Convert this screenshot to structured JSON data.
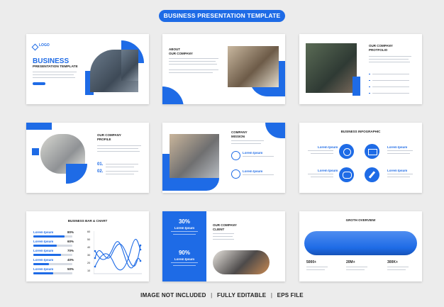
{
  "header": {
    "title": "BUSINESS PRESENTATION TEMPLATE"
  },
  "slide1": {
    "logo": "LOGO",
    "title": "BUSINESS",
    "subtitle": "PRESENTATION TEMPLATE"
  },
  "slide2": {
    "title": "ABOUT\nOUR COMPANY"
  },
  "slide3": {
    "title": "OUR COMPANY\nPROTFOLIO"
  },
  "slide4": {
    "title": "OUR COMPANY\nPROFILE",
    "num1": "01.",
    "num2": "02."
  },
  "slide5": {
    "title": "COMPANY\nMISSION",
    "item1": "Lorem Ipsum",
    "item2": "Lorem Ipsum"
  },
  "slide6": {
    "title": "BUSINESS INFOGRAPHIC",
    "labels": [
      "Lorem Ipsum",
      "Lorem Ipsum",
      "Lorem Ipsum",
      "Lorem Ipsum"
    ]
  },
  "slide7": {
    "title": "BUSINESS BAR & CHART",
    "bars": [
      {
        "label": "Lorem Ipsum",
        "pct": "80%",
        "value": 0.8
      },
      {
        "label": "Lorem Ipsum",
        "pct": "60%",
        "value": 0.6
      },
      {
        "label": "Lorem Ipsum",
        "pct": "70%",
        "value": 0.7
      },
      {
        "label": "Lorem Ipsum",
        "pct": "40%",
        "value": 0.4
      },
      {
        "label": "Lorem Ipsum",
        "pct": "50%",
        "value": 0.5
      }
    ],
    "yticks": [
      "60",
      "50",
      "40",
      "30",
      "20",
      "10"
    ]
  },
  "slide8": {
    "stat1": "30%",
    "stat2": "90%",
    "stat1_label": "Lorem Ipsum",
    "stat2_label": "Lorem Ipsum",
    "title": "OUR COMPANY\nCLIENT"
  },
  "slide9": {
    "title": "GROTH OVERVIEW",
    "stats": [
      "5000+",
      "20M+",
      "300K+"
    ]
  },
  "footer": {
    "items": [
      "IMAGE NOT INCLUDED",
      "FULLY EDITABLE",
      "EPS FILE"
    ]
  },
  "colors": {
    "accent": "#1e6be6",
    "background": "#ececec"
  }
}
